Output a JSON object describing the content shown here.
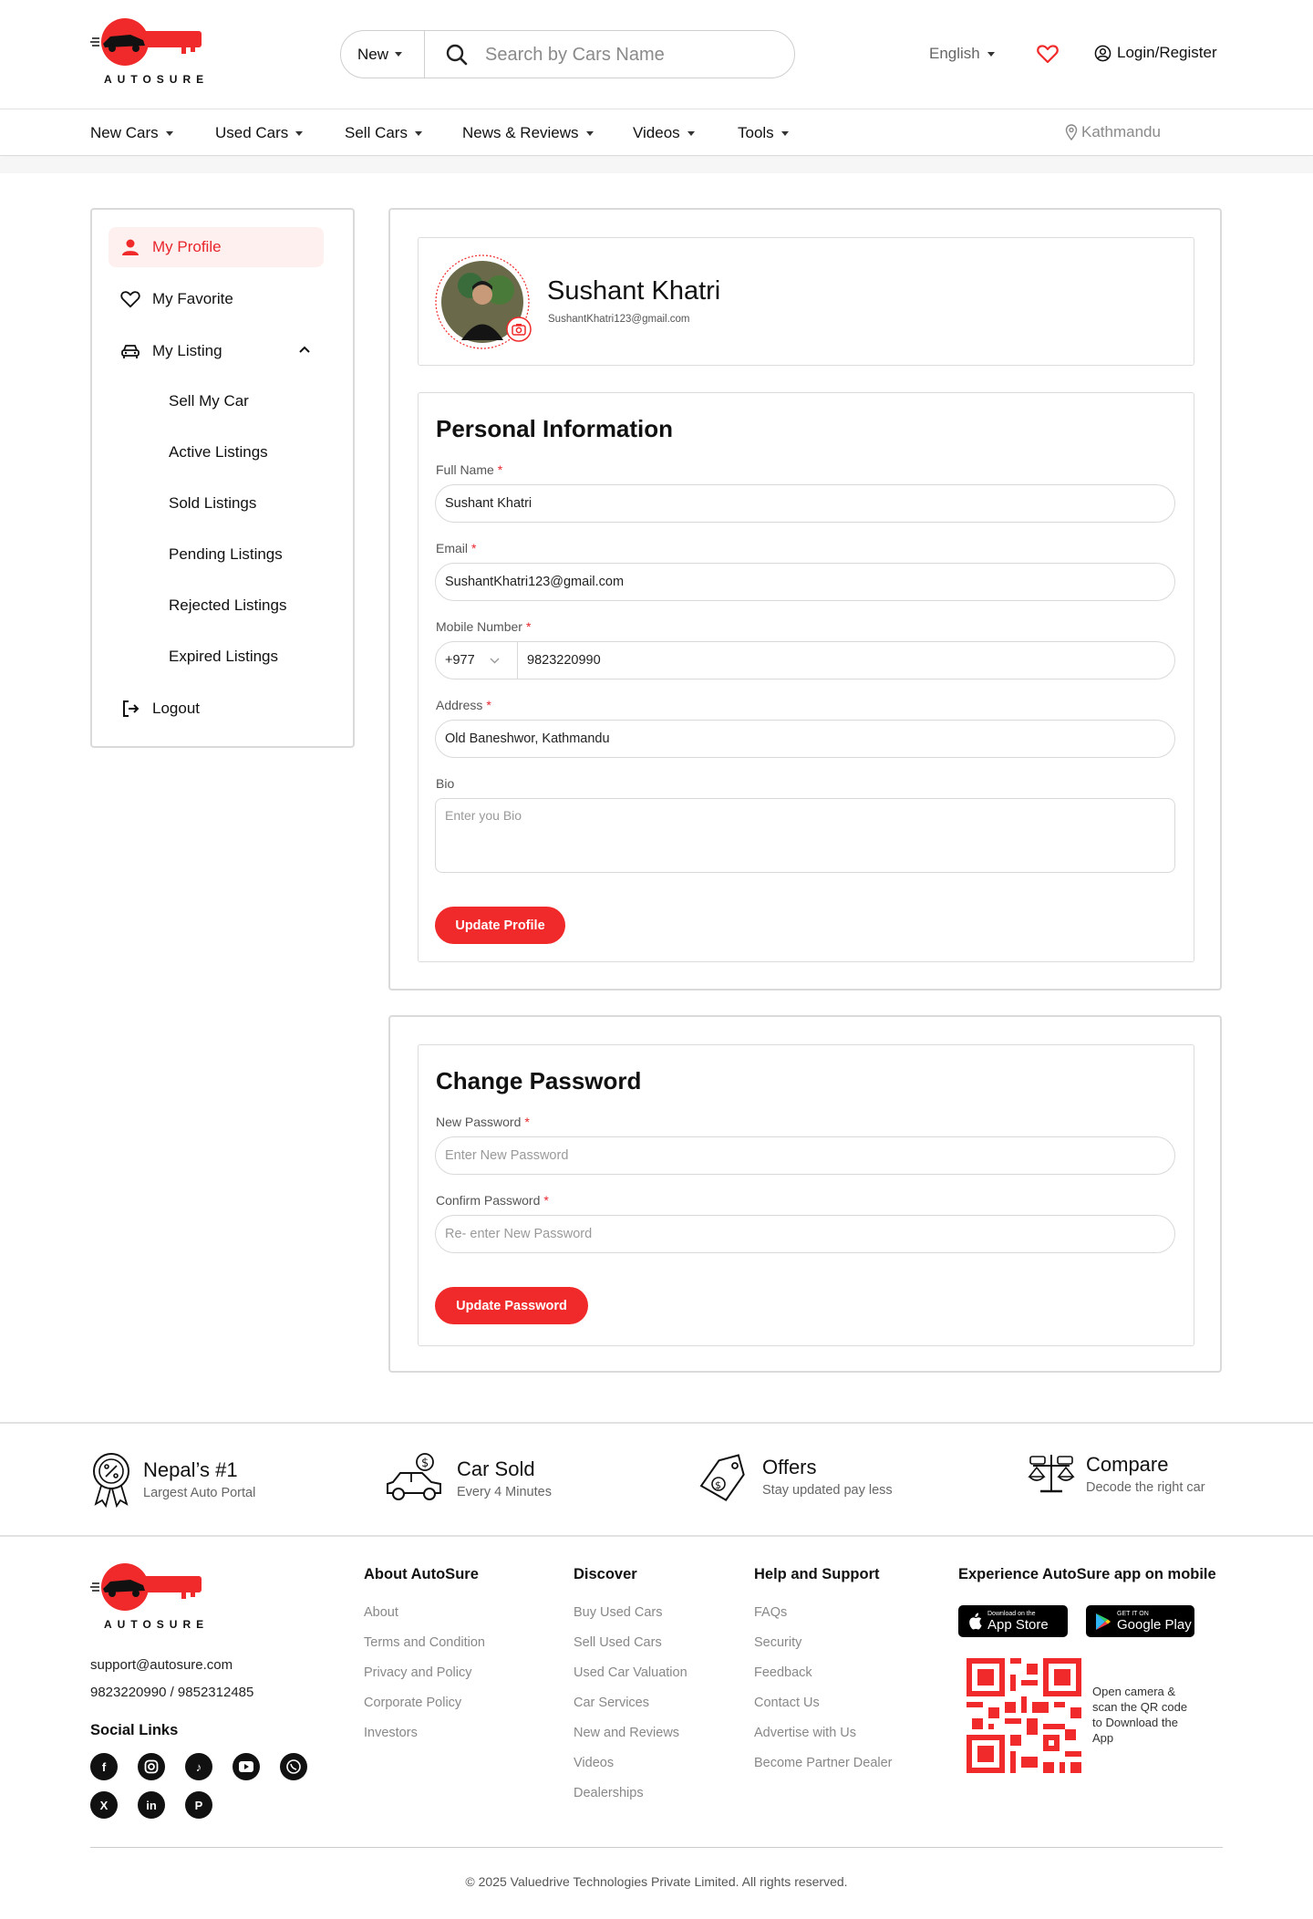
{
  "header": {
    "logo_text": "AUTOSURE",
    "search_select": "New",
    "search_placeholder": "Search by Cars Name",
    "language": "English",
    "login": "Login/Register"
  },
  "nav": {
    "items": [
      "New Cars",
      "Used Cars",
      "Sell Cars",
      "News & Reviews",
      "Videos",
      "Tools"
    ],
    "location": "Kathmandu"
  },
  "sidebar": {
    "my_profile": "My Profile",
    "my_favorite": "My Favorite",
    "my_listing": "My Listing",
    "sub_items": [
      "Sell My Car",
      "Active Listings",
      "Sold Listings",
      "Pending Listings",
      "Rejected Listings",
      "Expired Listings"
    ],
    "logout": "Logout"
  },
  "profile": {
    "name": "Sushant Khatri",
    "email": "SushantKhatri123@gmail.com"
  },
  "personal_info": {
    "title": "Personal Information",
    "full_name_label": "Full Name",
    "full_name": "Sushant Khatri",
    "email_label": "Email",
    "email": "SushantKhatri123@gmail.com",
    "mobile_label": "Mobile Number",
    "country_code": "+977",
    "mobile": "9823220990",
    "address_label": "Address",
    "address": "Old Baneshwor, Kathmandu",
    "bio_label": "Bio",
    "bio_placeholder": "Enter you Bio",
    "button": "Update Profile",
    "required_mark": "*"
  },
  "change_password": {
    "title": "Change Password",
    "new_label": "New Password",
    "new_placeholder": "Enter New Password",
    "confirm_label": "Confirm Password",
    "confirm_placeholder": "Re- enter New Password",
    "button": "Update Password"
  },
  "features": [
    {
      "title": "Nepal’s #1",
      "subtitle": "Largest Auto Portal",
      "icon": "badge-percent-icon"
    },
    {
      "title": "Car Sold",
      "subtitle": "Every 4 Minutes",
      "icon": "car-dollar-icon"
    },
    {
      "title": "Offers",
      "subtitle": "Stay updated pay less",
      "icon": "price-tag-icon"
    },
    {
      "title": "Compare",
      "subtitle": "Decode the right car",
      "icon": "compare-scale-icon"
    }
  ],
  "footer": {
    "logo_text": "AUTOSURE",
    "email": "support@autosure.com",
    "phones": "9823220990 / 9852312485",
    "social_title": "Social Links",
    "about": {
      "title": "About AutoSure",
      "links": [
        "About",
        "Terms and Condition",
        "Privacy and Policy",
        "Corporate Policy",
        "Investors"
      ]
    },
    "discover": {
      "title": "Discover",
      "links": [
        "Buy Used Cars",
        "Sell Used Cars",
        "Used Car Valuation",
        "Car Services",
        "New and Reviews",
        "Videos",
        "Dealerships"
      ]
    },
    "help": {
      "title": "Help and Support",
      "links": [
        "FAQs",
        "Security",
        "Feedback",
        "Contact Us",
        "Advertise with Us",
        "Become Partner Dealer"
      ]
    },
    "app": {
      "title": "Experience AutoSure app on mobile",
      "appstore_small": "Download on the",
      "appstore_big": "App Store",
      "play_small": "GET IT ON",
      "play_big": "Google Play",
      "qr_text": "Open camera & scan the QR code to Download the App"
    },
    "copyright": "© 2025 Valuedrive Technologies Private Limited. All rights reserved."
  },
  "colors": {
    "accent": "#f02a2a",
    "active_bg": "#fff0f0"
  }
}
